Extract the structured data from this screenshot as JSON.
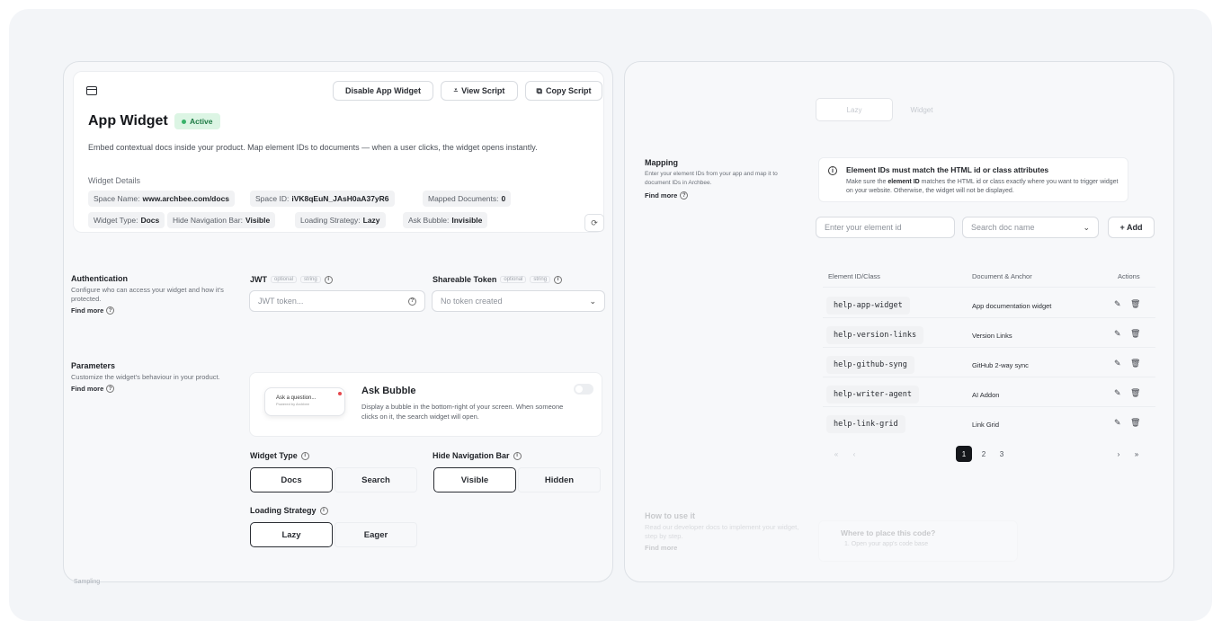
{
  "header": {
    "disable_label": "Disable App Widget",
    "view_script_label": "View Script",
    "copy_script_label": "Copy Script",
    "title": "App Widget",
    "status": "Active",
    "description": "Embed contextual docs inside your product. Map element IDs to documents — when a user clicks, the widget opens instantly.",
    "details_label": "Widget Details",
    "details": [
      {
        "label": "Space Name:",
        "value": "www.archbee.com/docs"
      },
      {
        "label": "Space ID:",
        "value": "iVK8qEuN_JAsH0aA37yR6"
      },
      {
        "label": "Mapped Documents:",
        "value": "0"
      },
      {
        "label": "Widget Type:",
        "value": "Docs"
      },
      {
        "label": "Hide Navigation Bar:",
        "value": "Visible"
      },
      {
        "label": "Loading Strategy:",
        "value": "Lazy"
      },
      {
        "label": "Ask Bubble:",
        "value": "Invisible"
      }
    ]
  },
  "authentication": {
    "title": "Authentication",
    "description": "Configure who can access your widget and how it's protected.",
    "find_more": "Find more",
    "jwt_label": "JWT",
    "jwt_tag1": "optional",
    "jwt_tag2": "string",
    "jwt_placeholder": "JWT token...",
    "shareable_label": "Shareable Token",
    "shareable_tag1": "optional",
    "shareable_tag2": "string",
    "shareable_value": "No token created"
  },
  "parameters": {
    "title": "Parameters",
    "description": "Customize the widget's behaviour in your product.",
    "find_more": "Find more",
    "bubble_preview_text": "Ask a question...",
    "bubble_preview_sub": "Powered by Archbee",
    "bubble_title": "Ask Bubble",
    "bubble_desc": "Display a bubble in the bottom-right of your screen. When someone clicks on it, the search widget will open.",
    "widget_type_label": "Widget Type",
    "widget_type_options": [
      "Docs",
      "Search"
    ],
    "hide_nav_label": "Hide Navigation Bar",
    "hide_nav_options": [
      "Visible",
      "Hidden"
    ],
    "loading_label": "Loading Strategy",
    "loading_options": [
      "Lazy",
      "Eager"
    ],
    "bottom_cut_label": "Sampling"
  },
  "mapping": {
    "tabs": [
      "Lazy",
      "Widget"
    ],
    "title": "Mapping",
    "description": "Enter your element IDs from your app and map it to document IDs in Archbee.",
    "find_more": "Find more",
    "note_title": "Element IDs must match the HTML id or class attributes",
    "note_body_pre": "Make sure the ",
    "note_body_bold": "element ID",
    "note_body_post": " matches the HTML id or class exactly where you want to trigger widget on your website. Otherwise, the widget will not be displayed.",
    "element_placeholder": "Enter your element id",
    "doc_placeholder": "Search doc name",
    "add_label": "+ Add",
    "columns": [
      "Element ID/Class",
      "Document & Anchor",
      "Actions"
    ],
    "rows": [
      {
        "id": "help-app-widget",
        "doc": "App documentation widget"
      },
      {
        "id": "help-version-links",
        "doc": "Version Links"
      },
      {
        "id": "help-github-syng",
        "doc": "GitHub 2-way sync"
      },
      {
        "id": "help-writer-agent",
        "doc": "AI Addon"
      },
      {
        "id": "help-link-grid",
        "doc": "Link Grid"
      }
    ],
    "pages": [
      "1",
      "2",
      "3"
    ],
    "first": "«",
    "prev": "‹",
    "next": "›",
    "last": "»"
  },
  "howto": {
    "title": "How to use it",
    "description": "Read our developer docs to implement your widget, step by step.",
    "find_more": "Find more",
    "card_title": "Where to place this code?",
    "card_body": "1. Open your app's code base"
  }
}
